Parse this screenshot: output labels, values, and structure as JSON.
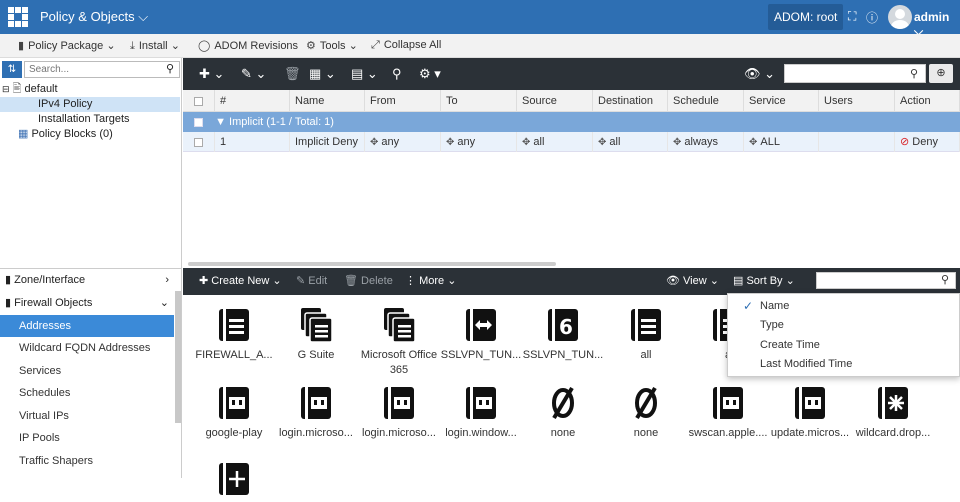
{
  "topbar": {
    "app_title": "Policy & Objects",
    "adom": "ADOM: root",
    "user": "admin"
  },
  "menubar": {
    "policy_package": "Policy Package",
    "install": "Install",
    "adom_revisions": "ADOM Revisions",
    "tools": "Tools",
    "collapse_all": "Collapse All"
  },
  "tree": {
    "search_placeholder": "Search...",
    "root": "default",
    "ipv4_policy": "IPv4 Policy",
    "installation_targets": "Installation Targets",
    "policy_blocks": "Policy Blocks (0)"
  },
  "accordion": {
    "zone_interface": "Zone/Interface",
    "firewall_objects": "Firewall Objects",
    "items": [
      "Addresses",
      "Wildcard FQDN Addresses",
      "Services",
      "Schedules",
      "Virtual IPs",
      "IP Pools",
      "Traffic Shapers"
    ]
  },
  "grid": {
    "headers": {
      "num": "#",
      "name": "Name",
      "from": "From",
      "to": "To",
      "source": "Source",
      "destination": "Destination",
      "schedule": "Schedule",
      "service": "Service",
      "users": "Users",
      "action": "Action"
    },
    "section": "Implicit (1-1 / Total: 1)",
    "row": {
      "num": "1",
      "name": "Implicit Deny",
      "from": "any",
      "to": "any",
      "source": "all",
      "destination": "all",
      "schedule": "always",
      "service": "ALL",
      "users": "",
      "action": "Deny"
    }
  },
  "objtool": {
    "create_new": "Create New",
    "edit": "Edit",
    "delete": "Delete",
    "more": "More",
    "view": "View",
    "sort_by": "Sort By"
  },
  "sort_menu": [
    "Name",
    "Type",
    "Create Time",
    "Last Modified Time"
  ],
  "objects": [
    {
      "label": "FIREWALL_A...",
      "icon": "address-icon"
    },
    {
      "label": "G Suite",
      "icon": "address-group-icon"
    },
    {
      "label": "Microsoft Office 365",
      "icon": "address-group-icon"
    },
    {
      "label": "SSLVPN_TUN...",
      "icon": "range-icon"
    },
    {
      "label": "SSLVPN_TUN...",
      "icon": "ipv6-icon"
    },
    {
      "label": "all",
      "icon": "address-icon"
    },
    {
      "label": "a",
      "icon": "address-icon"
    },
    {
      "label": "",
      "icon": "address-icon"
    },
    {
      "label": "google-play",
      "icon": "fqdn-icon"
    },
    {
      "label": "login.microso...",
      "icon": "fqdn-icon"
    },
    {
      "label": "login.microso...",
      "icon": "fqdn-icon"
    },
    {
      "label": "login.window...",
      "icon": "fqdn-icon"
    },
    {
      "label": "none",
      "icon": "none-icon"
    },
    {
      "label": "none",
      "icon": "none-icon"
    },
    {
      "label": "swscan.apple....",
      "icon": "fqdn-icon"
    },
    {
      "label": "update.micros...",
      "icon": "fqdn-icon"
    },
    {
      "label": "wildcard.drop...",
      "icon": "wildcard-icon"
    },
    {
      "label": "",
      "icon": "wildcard-icon"
    }
  ],
  "colors": {
    "topbar": "#2e6fb3",
    "toolbar": "#2b3137",
    "selected": "#3b8ad8",
    "section": "#7aa7d9",
    "deny": "#d9262b"
  }
}
